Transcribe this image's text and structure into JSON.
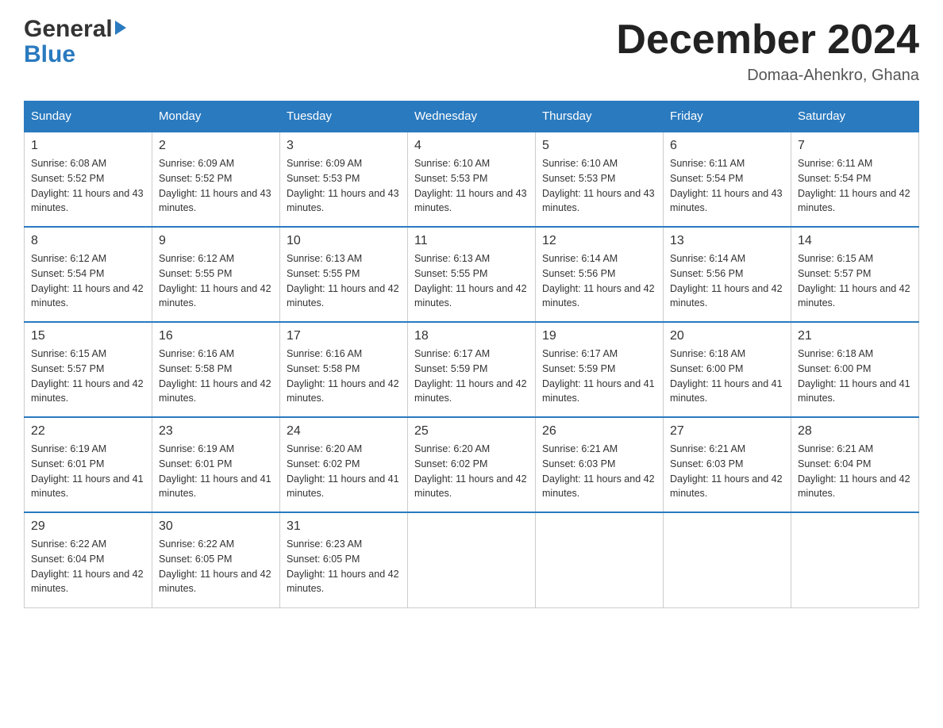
{
  "header": {
    "logo_general": "General",
    "logo_blue": "Blue",
    "month_title": "December 2024",
    "location": "Domaa-Ahenkro, Ghana"
  },
  "days_of_week": [
    "Sunday",
    "Monday",
    "Tuesday",
    "Wednesday",
    "Thursday",
    "Friday",
    "Saturday"
  ],
  "weeks": [
    [
      {
        "day": "1",
        "sunrise": "6:08 AM",
        "sunset": "5:52 PM",
        "daylight": "11 hours and 43 minutes."
      },
      {
        "day": "2",
        "sunrise": "6:09 AM",
        "sunset": "5:52 PM",
        "daylight": "11 hours and 43 minutes."
      },
      {
        "day": "3",
        "sunrise": "6:09 AM",
        "sunset": "5:53 PM",
        "daylight": "11 hours and 43 minutes."
      },
      {
        "day": "4",
        "sunrise": "6:10 AM",
        "sunset": "5:53 PM",
        "daylight": "11 hours and 43 minutes."
      },
      {
        "day": "5",
        "sunrise": "6:10 AM",
        "sunset": "5:53 PM",
        "daylight": "11 hours and 43 minutes."
      },
      {
        "day": "6",
        "sunrise": "6:11 AM",
        "sunset": "5:54 PM",
        "daylight": "11 hours and 43 minutes."
      },
      {
        "day": "7",
        "sunrise": "6:11 AM",
        "sunset": "5:54 PM",
        "daylight": "11 hours and 42 minutes."
      }
    ],
    [
      {
        "day": "8",
        "sunrise": "6:12 AM",
        "sunset": "5:54 PM",
        "daylight": "11 hours and 42 minutes."
      },
      {
        "day": "9",
        "sunrise": "6:12 AM",
        "sunset": "5:55 PM",
        "daylight": "11 hours and 42 minutes."
      },
      {
        "day": "10",
        "sunrise": "6:13 AM",
        "sunset": "5:55 PM",
        "daylight": "11 hours and 42 minutes."
      },
      {
        "day": "11",
        "sunrise": "6:13 AM",
        "sunset": "5:55 PM",
        "daylight": "11 hours and 42 minutes."
      },
      {
        "day": "12",
        "sunrise": "6:14 AM",
        "sunset": "5:56 PM",
        "daylight": "11 hours and 42 minutes."
      },
      {
        "day": "13",
        "sunrise": "6:14 AM",
        "sunset": "5:56 PM",
        "daylight": "11 hours and 42 minutes."
      },
      {
        "day": "14",
        "sunrise": "6:15 AM",
        "sunset": "5:57 PM",
        "daylight": "11 hours and 42 minutes."
      }
    ],
    [
      {
        "day": "15",
        "sunrise": "6:15 AM",
        "sunset": "5:57 PM",
        "daylight": "11 hours and 42 minutes."
      },
      {
        "day": "16",
        "sunrise": "6:16 AM",
        "sunset": "5:58 PM",
        "daylight": "11 hours and 42 minutes."
      },
      {
        "day": "17",
        "sunrise": "6:16 AM",
        "sunset": "5:58 PM",
        "daylight": "11 hours and 42 minutes."
      },
      {
        "day": "18",
        "sunrise": "6:17 AM",
        "sunset": "5:59 PM",
        "daylight": "11 hours and 42 minutes."
      },
      {
        "day": "19",
        "sunrise": "6:17 AM",
        "sunset": "5:59 PM",
        "daylight": "11 hours and 41 minutes."
      },
      {
        "day": "20",
        "sunrise": "6:18 AM",
        "sunset": "6:00 PM",
        "daylight": "11 hours and 41 minutes."
      },
      {
        "day": "21",
        "sunrise": "6:18 AM",
        "sunset": "6:00 PM",
        "daylight": "11 hours and 41 minutes."
      }
    ],
    [
      {
        "day": "22",
        "sunrise": "6:19 AM",
        "sunset": "6:01 PM",
        "daylight": "11 hours and 41 minutes."
      },
      {
        "day": "23",
        "sunrise": "6:19 AM",
        "sunset": "6:01 PM",
        "daylight": "11 hours and 41 minutes."
      },
      {
        "day": "24",
        "sunrise": "6:20 AM",
        "sunset": "6:02 PM",
        "daylight": "11 hours and 41 minutes."
      },
      {
        "day": "25",
        "sunrise": "6:20 AM",
        "sunset": "6:02 PM",
        "daylight": "11 hours and 42 minutes."
      },
      {
        "day": "26",
        "sunrise": "6:21 AM",
        "sunset": "6:03 PM",
        "daylight": "11 hours and 42 minutes."
      },
      {
        "day": "27",
        "sunrise": "6:21 AM",
        "sunset": "6:03 PM",
        "daylight": "11 hours and 42 minutes."
      },
      {
        "day": "28",
        "sunrise": "6:21 AM",
        "sunset": "6:04 PM",
        "daylight": "11 hours and 42 minutes."
      }
    ],
    [
      {
        "day": "29",
        "sunrise": "6:22 AM",
        "sunset": "6:04 PM",
        "daylight": "11 hours and 42 minutes."
      },
      {
        "day": "30",
        "sunrise": "6:22 AM",
        "sunset": "6:05 PM",
        "daylight": "11 hours and 42 minutes."
      },
      {
        "day": "31",
        "sunrise": "6:23 AM",
        "sunset": "6:05 PM",
        "daylight": "11 hours and 42 minutes."
      },
      null,
      null,
      null,
      null
    ]
  ]
}
